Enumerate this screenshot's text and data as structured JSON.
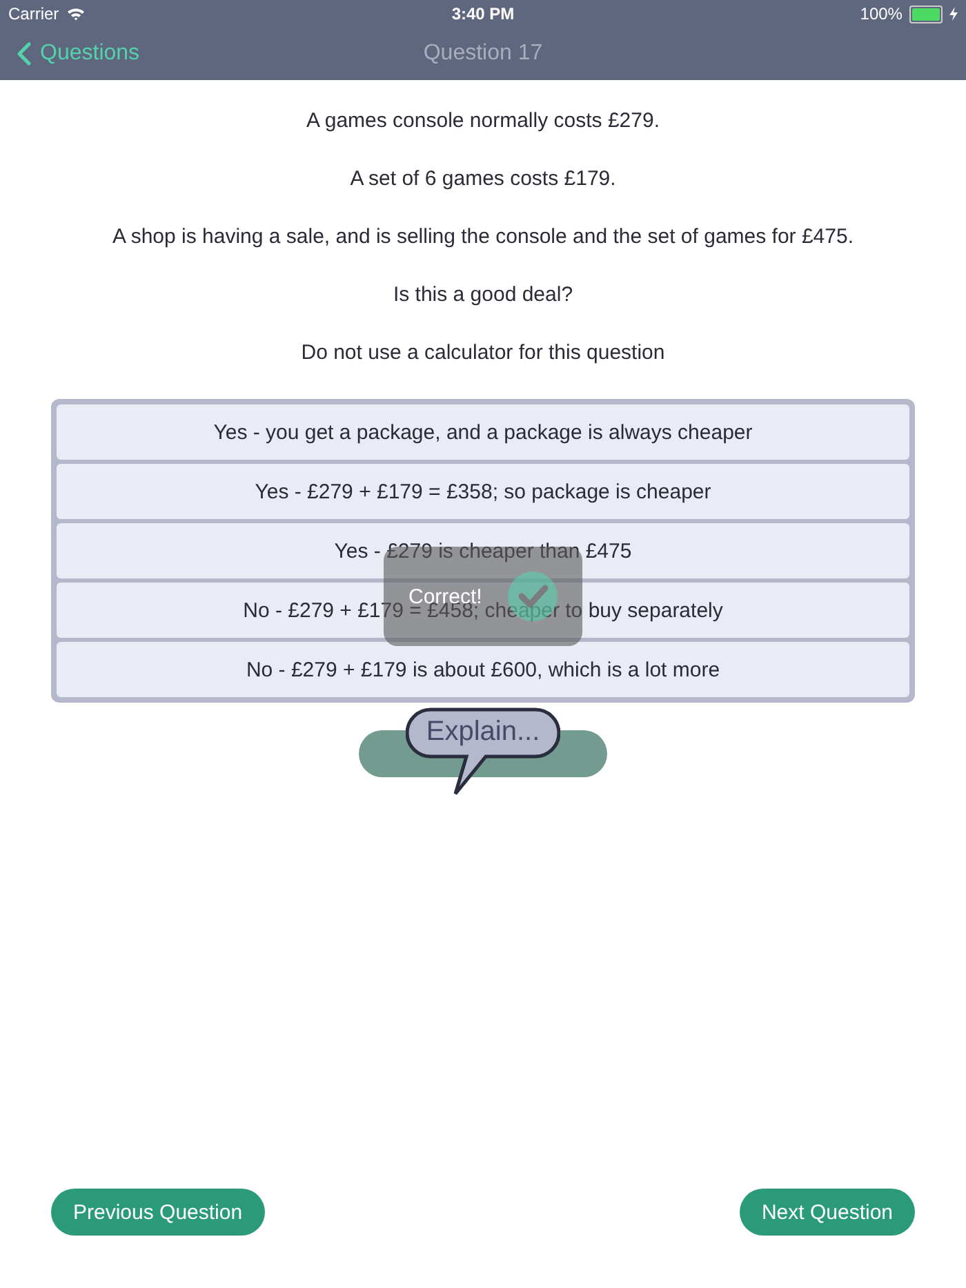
{
  "status_bar": {
    "carrier": "Carrier",
    "time": "3:40 PM",
    "battery": {
      "text": "100%",
      "level": 1
    }
  },
  "nav": {
    "back": "Questions",
    "title": "Question 17"
  },
  "question": [
    "A games console normally costs £279.",
    "A set of 6 games costs £179.",
    "A shop is having a sale, and is selling the console and the set of games for £475.",
    "Is this a good deal?",
    "Do not use a calculator for this question"
  ],
  "answers": [
    {
      "label": "Yes - you get a package, and a package is always cheaper"
    },
    {
      "label": "Yes - £279 + £179 = £358; so package is cheaper"
    },
    {
      "label": "Yes - £279 is cheaper than £475"
    },
    {
      "label": "No - £279 + £179 = £458; cheaper to buy separately"
    },
    {
      "label": "No - £279 + £179 is about £600, which is a lot more"
    }
  ],
  "feedback": {
    "text": "Correct!",
    "kind": "correct"
  },
  "explain": {
    "label": "Explain..."
  },
  "buttons": {
    "previous": "Previous Question",
    "next": "Next Question"
  }
}
